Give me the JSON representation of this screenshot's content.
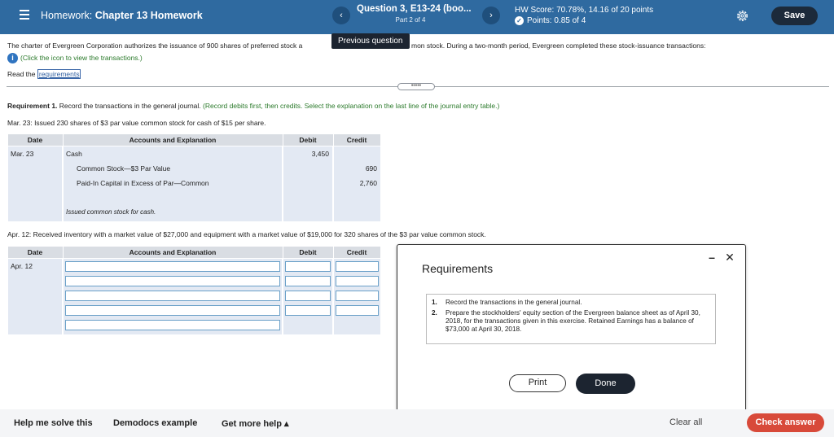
{
  "header": {
    "assignment_prefix": "Homework:",
    "assignment_name": "Chapter 13 Homework",
    "prev_icon": "‹",
    "next_icon": "›",
    "question_title": "Question 3, E13-24 (boo...",
    "question_part": "Part 2 of 4",
    "hw_score": "HW Score: 70.78%, 14.16 of 20 points",
    "points": "Points: 0.85 of 4",
    "save_label": "Save",
    "icons": [
      "menu-icon",
      "chevron-left-icon",
      "chevron-right-icon",
      "check-circle-icon",
      "gear-icon"
    ],
    "colors": {
      "header_bg": "#2f6aa0",
      "save_bg": "#1c2a3a",
      "check_answer_bg": "#d84a3a"
    }
  },
  "tooltip": "Previous question",
  "problem": {
    "text_left": "The charter of Evergreen Corporation authorizes the issuance of 900 shares of preferred stock a",
    "text_right": "mon stock. During a two-month period, Evergreen completed these stock-issuance transactions:",
    "info_icon": "i",
    "info_text": "(Click the icon to view the transactions.)",
    "read_prefix": "Read the",
    "read_link": "requirements",
    "divider_handle": "•••••"
  },
  "requirement1": {
    "label": "Requirement 1.",
    "text": "Record the transactions in the general journal.",
    "hint": "(Record debits first, then credits. Select the explanation on the last line of the journal entry table.)"
  },
  "transaction1": {
    "text": "Mar. 23: Issued 230 shares of $3 par value common stock for cash of $15 per share.",
    "headers": {
      "date": "Date",
      "accounts": "Accounts and Explanation",
      "debit": "Debit",
      "credit": "Credit"
    },
    "date": "Mar. 23",
    "rows": [
      {
        "account": "Cash",
        "debit": "3,450",
        "credit": ""
      },
      {
        "account": "Common Stock—$3 Par Value",
        "debit": "",
        "credit": "690"
      },
      {
        "account": "Paid-In Capital in Excess of Par—Common",
        "debit": "",
        "credit": "2,760"
      }
    ],
    "explanation": "Issued common stock for cash."
  },
  "transaction2": {
    "text": "Apr. 12: Received inventory with a market value of $27,000 and equipment with a market value of $19,000 for 320 shares of the $3 par value common stock.",
    "headers": {
      "date": "Date",
      "accounts": "Accounts and Explanation",
      "debit": "Debit",
      "credit": "Credit"
    },
    "date": "Apr. 12"
  },
  "modal": {
    "title": "Requirements",
    "minimize": "–",
    "close": "✕",
    "items": [
      {
        "n": "1.",
        "text": "Record the transactions in the general journal."
      },
      {
        "n": "2.",
        "text": "Prepare the stockholders' equity section of the Evergreen balance sheet as of April 30, 2018, for the transactions given in this exercise. Retained Earnings has a balance of $73,000 at April 30, 2018."
      }
    ],
    "print_label": "Print",
    "done_label": "Done"
  },
  "footer": {
    "help_me_solve": "Help me solve this",
    "demodocs": "Demodocs example",
    "get_more_help": "Get more help ▴",
    "clear_all": "Clear all",
    "check_answer": "Check answer"
  }
}
